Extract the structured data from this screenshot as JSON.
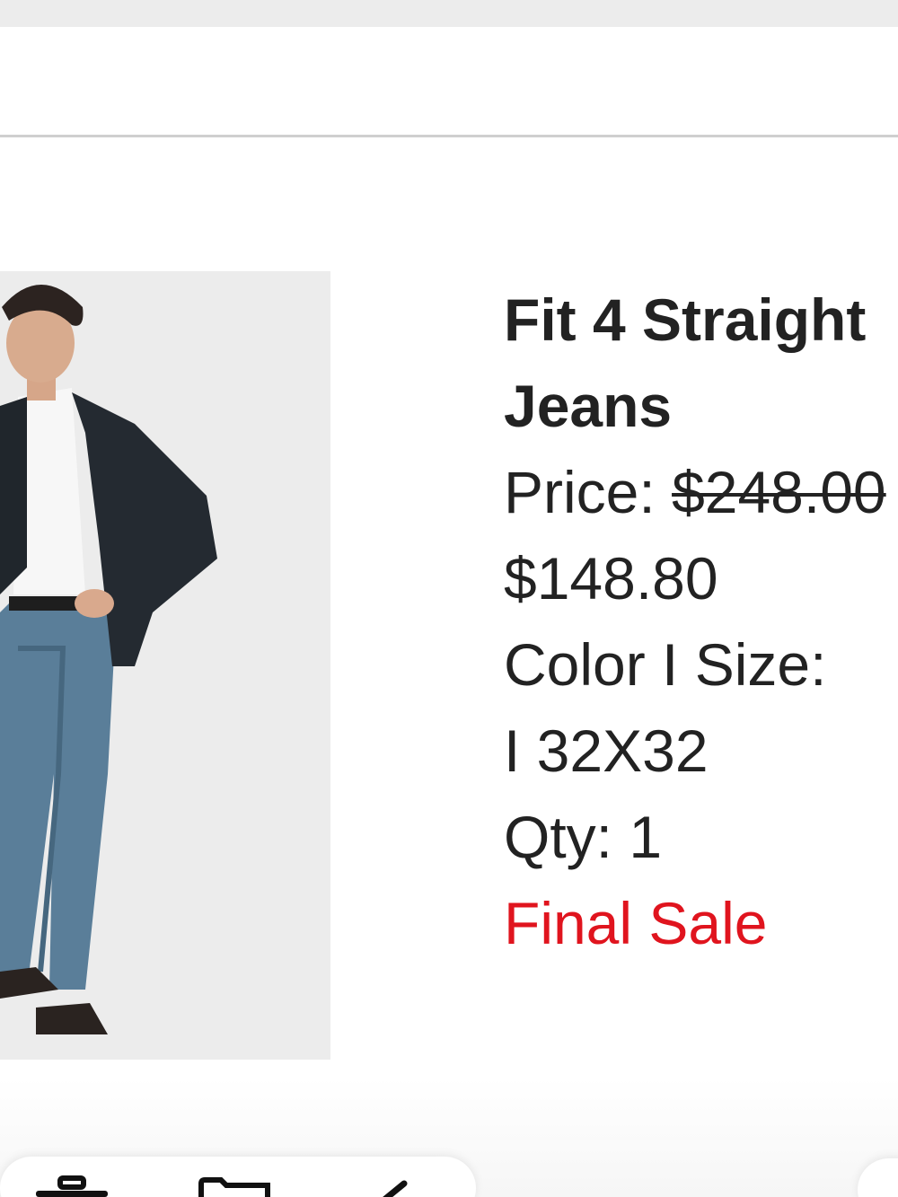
{
  "product": {
    "name": "Fit 4 Straight Jeans",
    "price_label": "Price:",
    "original_price": "$248.00",
    "sale_price": "$148.80",
    "color_size_label": "Color I Size:",
    "color_size_value": "I 32X32",
    "qty_label": "Qty: 1",
    "final_sale": "Final Sale"
  },
  "image": {
    "icon": "product-photo"
  },
  "bottom_bar": {
    "icons": [
      "trash-icon",
      "folder-icon",
      "edit-icon"
    ]
  },
  "colors": {
    "text": "#222222",
    "final_sale": "#e0141e",
    "divider": "#cfcfcf"
  }
}
